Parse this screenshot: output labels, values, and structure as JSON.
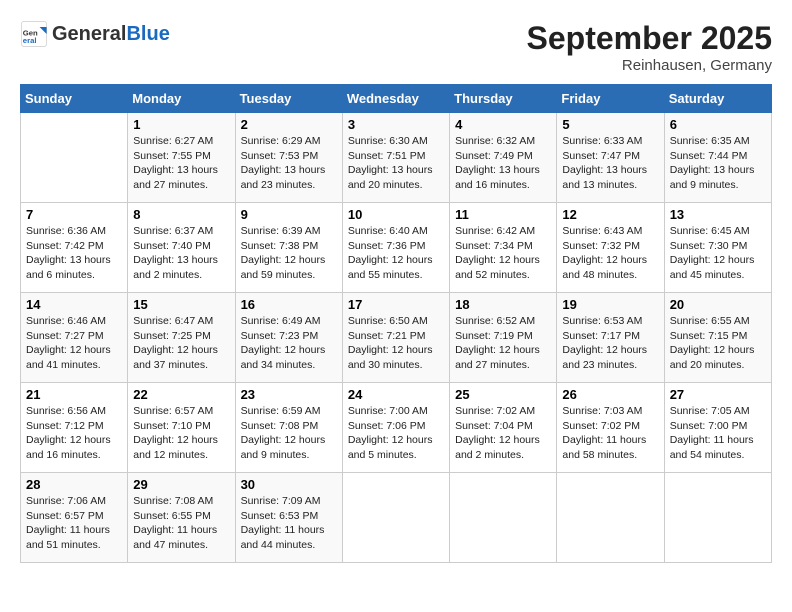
{
  "header": {
    "logo_general": "General",
    "logo_blue": "Blue",
    "month": "September 2025",
    "location": "Reinhausen, Germany"
  },
  "days_of_week": [
    "Sunday",
    "Monday",
    "Tuesday",
    "Wednesday",
    "Thursday",
    "Friday",
    "Saturday"
  ],
  "weeks": [
    [
      {
        "day": "",
        "info": ""
      },
      {
        "day": "1",
        "info": "Sunrise: 6:27 AM\nSunset: 7:55 PM\nDaylight: 13 hours\nand 27 minutes."
      },
      {
        "day": "2",
        "info": "Sunrise: 6:29 AM\nSunset: 7:53 PM\nDaylight: 13 hours\nand 23 minutes."
      },
      {
        "day": "3",
        "info": "Sunrise: 6:30 AM\nSunset: 7:51 PM\nDaylight: 13 hours\nand 20 minutes."
      },
      {
        "day": "4",
        "info": "Sunrise: 6:32 AM\nSunset: 7:49 PM\nDaylight: 13 hours\nand 16 minutes."
      },
      {
        "day": "5",
        "info": "Sunrise: 6:33 AM\nSunset: 7:47 PM\nDaylight: 13 hours\nand 13 minutes."
      },
      {
        "day": "6",
        "info": "Sunrise: 6:35 AM\nSunset: 7:44 PM\nDaylight: 13 hours\nand 9 minutes."
      }
    ],
    [
      {
        "day": "7",
        "info": "Sunrise: 6:36 AM\nSunset: 7:42 PM\nDaylight: 13 hours\nand 6 minutes."
      },
      {
        "day": "8",
        "info": "Sunrise: 6:37 AM\nSunset: 7:40 PM\nDaylight: 13 hours\nand 2 minutes."
      },
      {
        "day": "9",
        "info": "Sunrise: 6:39 AM\nSunset: 7:38 PM\nDaylight: 12 hours\nand 59 minutes."
      },
      {
        "day": "10",
        "info": "Sunrise: 6:40 AM\nSunset: 7:36 PM\nDaylight: 12 hours\nand 55 minutes."
      },
      {
        "day": "11",
        "info": "Sunrise: 6:42 AM\nSunset: 7:34 PM\nDaylight: 12 hours\nand 52 minutes."
      },
      {
        "day": "12",
        "info": "Sunrise: 6:43 AM\nSunset: 7:32 PM\nDaylight: 12 hours\nand 48 minutes."
      },
      {
        "day": "13",
        "info": "Sunrise: 6:45 AM\nSunset: 7:30 PM\nDaylight: 12 hours\nand 45 minutes."
      }
    ],
    [
      {
        "day": "14",
        "info": "Sunrise: 6:46 AM\nSunset: 7:27 PM\nDaylight: 12 hours\nand 41 minutes."
      },
      {
        "day": "15",
        "info": "Sunrise: 6:47 AM\nSunset: 7:25 PM\nDaylight: 12 hours\nand 37 minutes."
      },
      {
        "day": "16",
        "info": "Sunrise: 6:49 AM\nSunset: 7:23 PM\nDaylight: 12 hours\nand 34 minutes."
      },
      {
        "day": "17",
        "info": "Sunrise: 6:50 AM\nSunset: 7:21 PM\nDaylight: 12 hours\nand 30 minutes."
      },
      {
        "day": "18",
        "info": "Sunrise: 6:52 AM\nSunset: 7:19 PM\nDaylight: 12 hours\nand 27 minutes."
      },
      {
        "day": "19",
        "info": "Sunrise: 6:53 AM\nSunset: 7:17 PM\nDaylight: 12 hours\nand 23 minutes."
      },
      {
        "day": "20",
        "info": "Sunrise: 6:55 AM\nSunset: 7:15 PM\nDaylight: 12 hours\nand 20 minutes."
      }
    ],
    [
      {
        "day": "21",
        "info": "Sunrise: 6:56 AM\nSunset: 7:12 PM\nDaylight: 12 hours\nand 16 minutes."
      },
      {
        "day": "22",
        "info": "Sunrise: 6:57 AM\nSunset: 7:10 PM\nDaylight: 12 hours\nand 12 minutes."
      },
      {
        "day": "23",
        "info": "Sunrise: 6:59 AM\nSunset: 7:08 PM\nDaylight: 12 hours\nand 9 minutes."
      },
      {
        "day": "24",
        "info": "Sunrise: 7:00 AM\nSunset: 7:06 PM\nDaylight: 12 hours\nand 5 minutes."
      },
      {
        "day": "25",
        "info": "Sunrise: 7:02 AM\nSunset: 7:04 PM\nDaylight: 12 hours\nand 2 minutes."
      },
      {
        "day": "26",
        "info": "Sunrise: 7:03 AM\nSunset: 7:02 PM\nDaylight: 11 hours\nand 58 minutes."
      },
      {
        "day": "27",
        "info": "Sunrise: 7:05 AM\nSunset: 7:00 PM\nDaylight: 11 hours\nand 54 minutes."
      }
    ],
    [
      {
        "day": "28",
        "info": "Sunrise: 7:06 AM\nSunset: 6:57 PM\nDaylight: 11 hours\nand 51 minutes."
      },
      {
        "day": "29",
        "info": "Sunrise: 7:08 AM\nSunset: 6:55 PM\nDaylight: 11 hours\nand 47 minutes."
      },
      {
        "day": "30",
        "info": "Sunrise: 7:09 AM\nSunset: 6:53 PM\nDaylight: 11 hours\nand 44 minutes."
      },
      {
        "day": "",
        "info": ""
      },
      {
        "day": "",
        "info": ""
      },
      {
        "day": "",
        "info": ""
      },
      {
        "day": "",
        "info": ""
      }
    ]
  ]
}
